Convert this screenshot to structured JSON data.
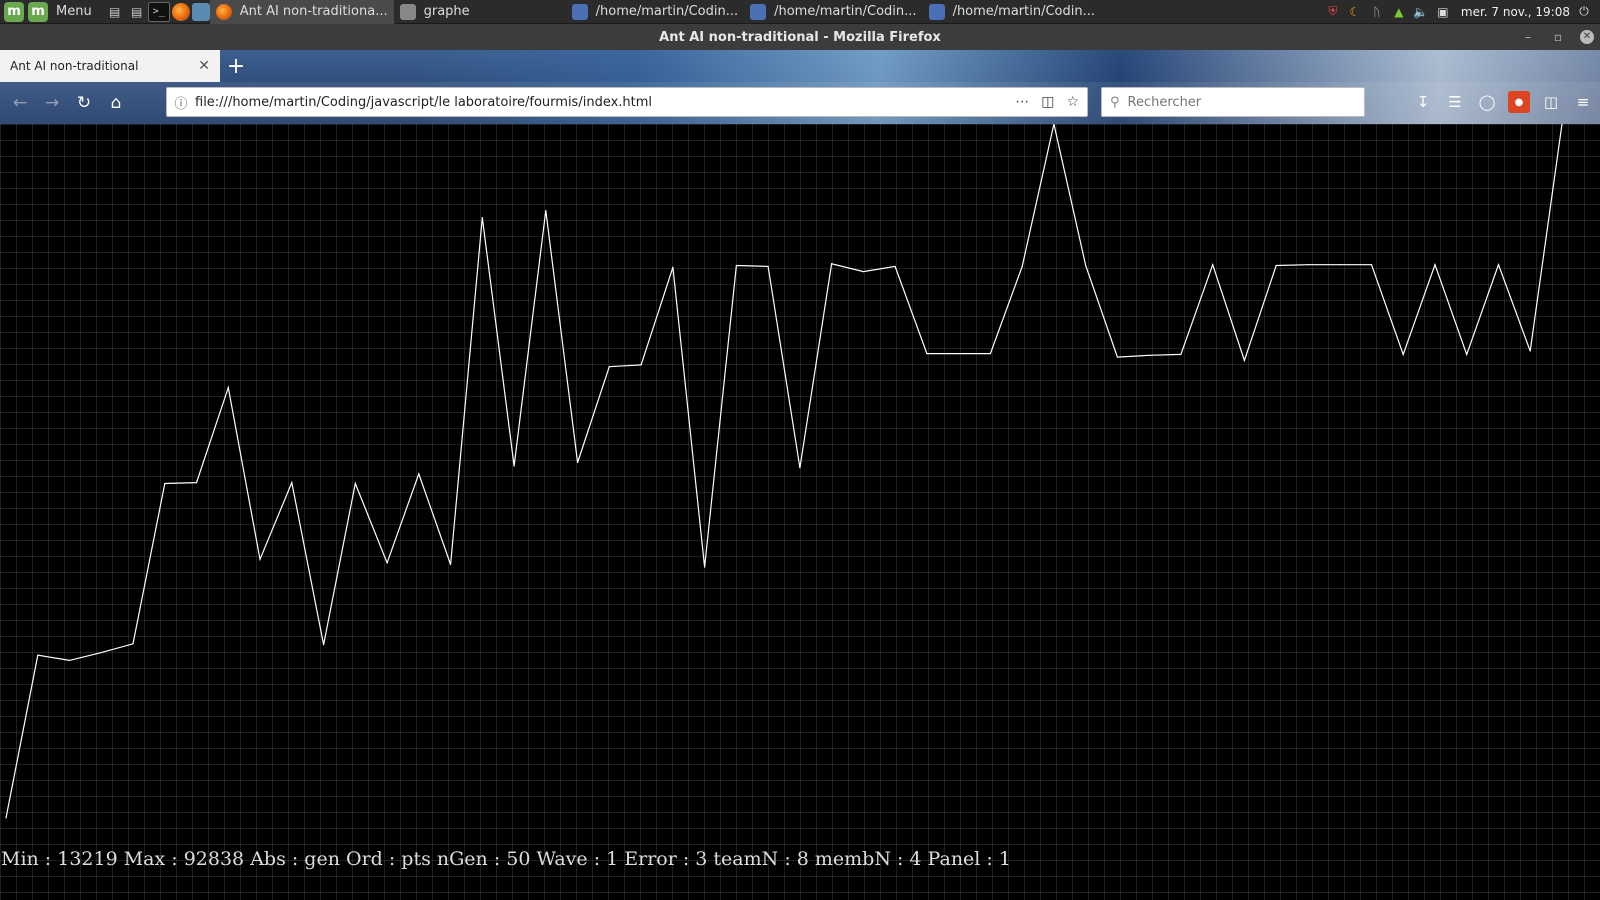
{
  "taskbar": {
    "menu_label": "Menu",
    "windows": [
      {
        "label": "Ant AI non-traditiona...",
        "icon": "firefox-icon",
        "active": true
      },
      {
        "label": "graphe",
        "icon": "folder-icon",
        "active": false
      },
      {
        "label": "/home/martin/Codin...",
        "icon": "editor-icon",
        "active": false
      },
      {
        "label": "/home/martin/Codin...",
        "icon": "editor-icon",
        "active": false
      },
      {
        "label": "/home/martin/Codin...",
        "icon": "editor-icon",
        "active": false
      }
    ],
    "clock": "mer. 7 nov., 19:08"
  },
  "window": {
    "title": "Ant AI non-traditional - Mozilla Firefox"
  },
  "browser": {
    "tab_title": "Ant AI non-traditional",
    "url": "file:///home/martin/Coding/javascript/le laboratoire/fourmis/index.html",
    "search_placeholder": "Rechercher"
  },
  "stats": {
    "text": "Min : 13219 Max : 92838 Abs : gen Ord : pts nGen : 50 Wave : 1 Error : 3 teamN : 8 membN : 4 Panel : 1"
  },
  "chart_data": {
    "type": "line",
    "title": "",
    "xlabel": "gen",
    "ylabel": "pts",
    "ylim": [
      13219,
      92838
    ],
    "x": [
      0,
      1,
      2,
      3,
      4,
      5,
      6,
      7,
      8,
      9,
      10,
      11,
      12,
      13,
      14,
      15,
      16,
      17,
      18,
      19,
      20,
      21,
      22,
      23,
      24,
      25,
      26,
      27,
      28,
      29,
      30,
      31,
      32,
      33,
      34,
      35,
      36,
      37,
      38,
      39,
      40,
      41,
      42,
      43,
      44,
      45,
      46,
      47,
      48,
      49
    ],
    "series": [
      {
        "values": [
          13219,
          31900,
          31300,
          32200,
          33200,
          51600,
          51700,
          62600,
          42900,
          51700,
          33100,
          51600,
          42500,
          52700,
          42300,
          82100,
          53600,
          82900,
          54000,
          65000,
          65200,
          76400,
          42000,
          76600,
          76500,
          53400,
          76800,
          75900,
          76500,
          66500,
          66500,
          66500,
          76500,
          92838,
          76600,
          66100,
          66300,
          66400,
          76700,
          65700,
          76600,
          76700,
          76700,
          76700,
          66400,
          76700,
          66400,
          76700,
          66800,
          92838
        ]
      }
    ],
    "grid": true,
    "legend": "none"
  }
}
